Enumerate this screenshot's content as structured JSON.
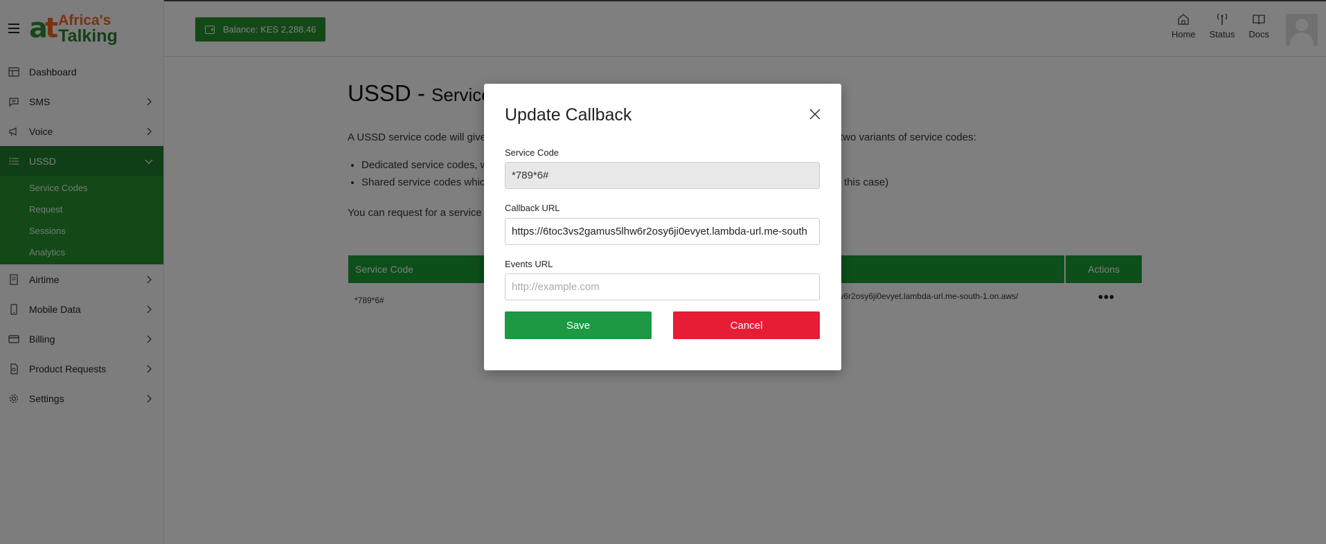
{
  "brand": {
    "line1": "Africa's",
    "line2": "Talking",
    "mark_a": "a",
    "mark_t": "t"
  },
  "balance": {
    "label": "Balance: KES 2,288.46"
  },
  "topnav": [
    {
      "label": "Home",
      "icon": "home-icon"
    },
    {
      "label": "Status",
      "icon": "status-icon"
    },
    {
      "label": "Docs",
      "icon": "docs-icon"
    }
  ],
  "sidebar": {
    "items": [
      {
        "label": "Dashboard",
        "icon": "dashboard-icon",
        "chevron": false
      },
      {
        "label": "SMS",
        "icon": "sms-icon",
        "chevron": true
      },
      {
        "label": "Voice",
        "icon": "voice-icon",
        "chevron": true
      },
      {
        "label": "USSD",
        "icon": "list-icon",
        "chevron": true,
        "active": true
      },
      {
        "label": "Airtime",
        "icon": "airtime-icon",
        "chevron": true
      },
      {
        "label": "Mobile Data",
        "icon": "mobile-icon",
        "chevron": true
      },
      {
        "label": "Billing",
        "icon": "card-icon",
        "chevron": true
      },
      {
        "label": "Product Requests",
        "icon": "requests-icon",
        "chevron": true
      },
      {
        "label": "Settings",
        "icon": "gear-icon",
        "chevron": true
      }
    ],
    "ussd_sub": [
      "Service Codes",
      "Request",
      "Sessions",
      "Analytics"
    ]
  },
  "main": {
    "title": "USSD - ",
    "title_sub": "Service C",
    "intro": "A USSD service code will give y                                                                                                    two variants of service codes:",
    "intro_left": "A USSD service code will give y",
    "intro_right": "two variants of service codes:",
    "bullet1": "Dedicated service codes, w",
    "bullet2_left": "Shared service codes which",
    "bullet2_right": "this case)",
    "request_text": "You can request for a service c",
    "table": {
      "headers": {
        "service_code": "Service Code",
        "actions": "Actions"
      },
      "rows": [
        {
          "code": "*789*6#",
          "url_fragment": "hw6r2osy6ji0evyet.lambda-url.me-south-1.on.aws/",
          "actions": "•••"
        }
      ]
    }
  },
  "modal": {
    "title": "Update Callback",
    "service_code_label": "Service Code",
    "service_code_value": "*789*6#",
    "callback_label": "Callback URL",
    "callback_value": "https://6toc3vs2gamus5lhw6r2osy6ji0evyet.lambda-url.me-south",
    "events_label": "Events URL",
    "events_placeholder": "http://example.com",
    "save_label": "Save",
    "cancel_label": "Cancel"
  },
  "colors": {
    "brand_green": "#27922f",
    "save_green": "#1c9942",
    "cancel_red": "#e71d36",
    "brand_orange": "#f26522"
  }
}
